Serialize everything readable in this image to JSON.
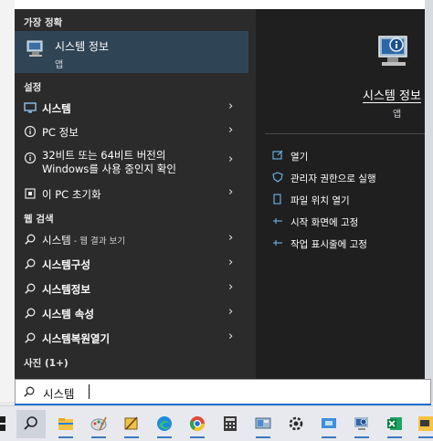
{
  "search": {
    "value": "시스템",
    "icon": "search-icon"
  },
  "left": {
    "best_match_header": "가장 정확",
    "best_match": {
      "title": "시스템 정보",
      "subtitle": "앱",
      "icon": "system-info-icon"
    },
    "settings_header": "설정",
    "settings_items": [
      {
        "label": "시스템",
        "icon": "display-icon"
      },
      {
        "label": "PC 정보",
        "icon": "info-icon"
      },
      {
        "label_line1": "32비트 또는 64비트 버전의",
        "label_line2": "Windows를 사용 중인지 확인",
        "icon": "info-icon"
      },
      {
        "label": "이 PC 초기화",
        "icon": "reset-icon"
      }
    ],
    "web_header": "웹 검색",
    "web_items": [
      {
        "bold": "시스템",
        "suffix": " - 웹 결과 보기",
        "icon": "search-icon"
      },
      {
        "bold": "시스템구성",
        "icon": "search-icon"
      },
      {
        "bold": "시스템정보",
        "icon": "search-icon"
      },
      {
        "bold": "시스템 속성",
        "icon": "search-icon"
      },
      {
        "bold": "시스템복원열기",
        "icon": "search-icon"
      }
    ],
    "photos_header": "사진 (1+)"
  },
  "right": {
    "app_title": "시스템 정보",
    "app_subtitle": "앱",
    "actions": [
      {
        "label": "열기",
        "icon": "open-icon"
      },
      {
        "label": "관리자 권한으로 실행",
        "icon": "shield-icon"
      },
      {
        "label": "파일 위치 열기",
        "icon": "file-location-icon"
      },
      {
        "label": "시작 화면에 고정",
        "icon": "pin-icon"
      },
      {
        "label": "작업 표시줄에 고정",
        "icon": "pin-icon"
      }
    ]
  },
  "taskbar": {
    "items": [
      "windows-icon",
      "search-icon",
      "file-explorer-icon",
      "paint-icon",
      "snipping-tool-icon",
      "edge-icon",
      "chrome-icon",
      "calculator-icon",
      "control-panel-icon",
      "settings-icon",
      "remote-desktop-icon",
      "system-info-icon",
      "excel-icon",
      "sticky-notes-icon"
    ]
  },
  "colors": {
    "panel_left": "#2b2b2b",
    "panel_right": "#1f1f1f",
    "selected": "#2f4556",
    "accent": "#1e6fd1"
  }
}
